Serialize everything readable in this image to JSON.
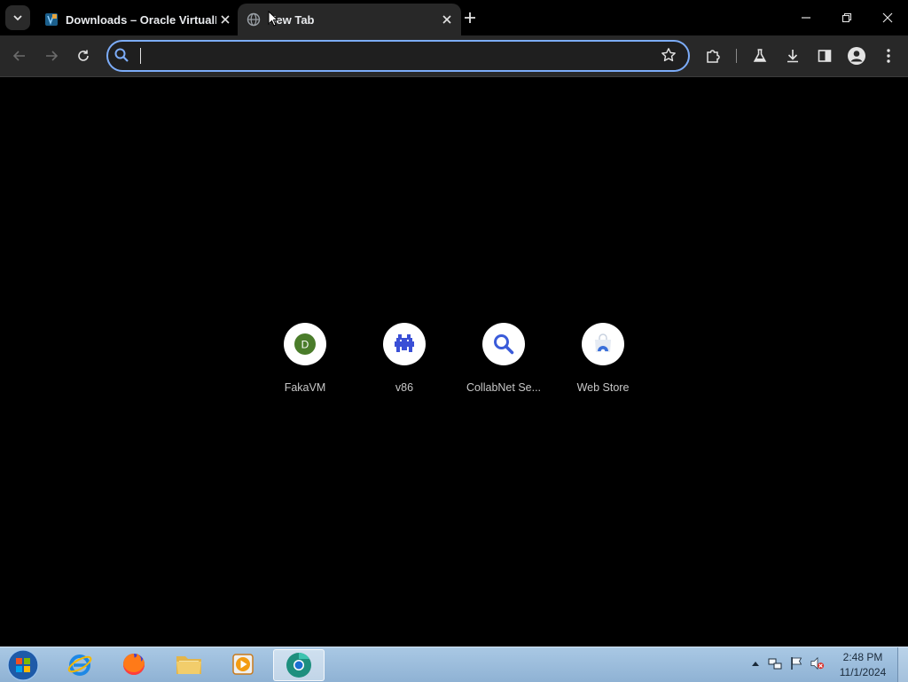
{
  "tabs": [
    {
      "title": "Downloads – Oracle VirtualBox",
      "favicon": "virtualbox-icon",
      "active": false
    },
    {
      "title": "New Tab",
      "favicon": "globe-icon",
      "active": true
    }
  ],
  "omnibox": {
    "value": "",
    "placeholder": ""
  },
  "shortcuts": [
    {
      "label": "FakaVM",
      "icon": "letter-d-icon",
      "letter": "D",
      "color": "#4a7c2a"
    },
    {
      "label": "v86",
      "icon": "pixel-monster-icon",
      "color": "#3a4fd6"
    },
    {
      "label": "CollabNet Se...",
      "icon": "search-icon",
      "color": "#3a5bd9"
    },
    {
      "label": "Web Store",
      "icon": "web-store-icon",
      "color": "#3a6fd9"
    }
  ],
  "taskbar": {
    "apps": [
      "internet-explorer-icon",
      "firefox-icon",
      "file-explorer-icon",
      "media-player-icon",
      "chromium-icon"
    ],
    "time": "2:48 PM",
    "date": "11/1/2024"
  },
  "colors": {
    "accent": "#7cacf8",
    "toolbar": "#282828",
    "tabstrip": "#000000"
  }
}
